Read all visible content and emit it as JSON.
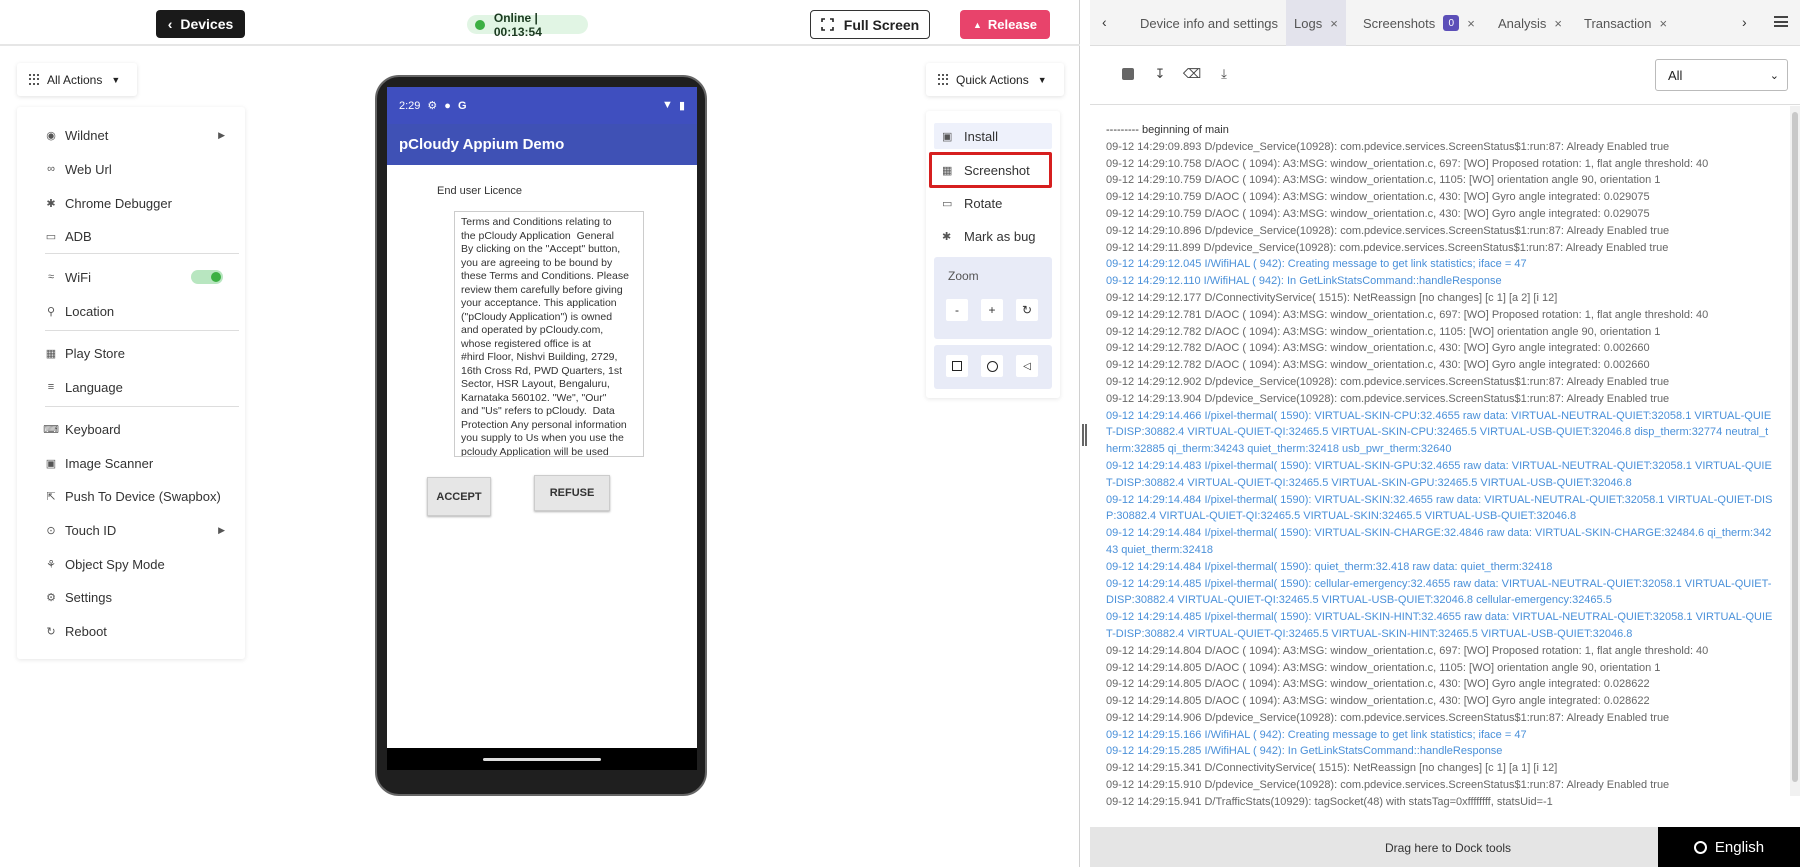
{
  "topbar": {
    "devices_label": "Devices",
    "status_text": "Online | 00:13:54",
    "fullscreen_label": "Full Screen",
    "release_label": "Release"
  },
  "all_actions": {
    "label": "All Actions",
    "items": [
      {
        "label": "Wildnet",
        "icon": "wildnet-icon"
      },
      {
        "label": "Web Url",
        "icon": "link-icon"
      },
      {
        "label": "Chrome Debugger",
        "icon": "bug-icon"
      },
      {
        "label": "ADB",
        "icon": "terminal-icon"
      },
      {
        "label": "WiFi",
        "icon": "wifi-icon"
      },
      {
        "label": "Location",
        "icon": "location-icon"
      },
      {
        "label": "Play Store",
        "icon": "apps-icon"
      },
      {
        "label": "Language",
        "icon": "language-icon"
      },
      {
        "label": "Keyboard",
        "icon": "keyboard-icon"
      },
      {
        "label": "Image Scanner",
        "icon": "scanner-icon"
      },
      {
        "label": "Push To Device (Swapbox)",
        "icon": "push-icon"
      },
      {
        "label": "Touch ID",
        "icon": "fingerprint-icon"
      },
      {
        "label": "Object Spy Mode",
        "icon": "spy-icon"
      },
      {
        "label": "Settings",
        "icon": "gear-icon"
      },
      {
        "label": "Reboot",
        "icon": "reboot-icon"
      }
    ]
  },
  "phone": {
    "time": "2:29",
    "status_g": "G",
    "app_title": "pCloudy Appium Demo",
    "licence_title": "End user Licence",
    "terms_text": "Terms and Conditions relating to\nthe pCloudy Application  General\nBy clicking on the \"Accept\" button,\nyou are agreeing to be bound by\nthese Terms and Conditions. Please\nreview them carefully before giving\nyour acceptance. This application\n(\"pCloudy Application\") is owned\nand operated by pCloudy.com,\nwhose registered office is at\n#hird Floor, Nishvi Building, 2729,\n16th Cross Rd, PWD Quarters, 1st\nSector, HSR Layout, Bengaluru,\nKarnataka 560102. \"We\", \"Our\"\nand \"Us\" refers to pCloudy.  Data\nProtection Any personal information\nyou supply to Us when you use the\npcloudy Application will be used\nin accordance with Our Privacy\nPolicy which can be viewed at",
    "accept_label": "ACCEPT",
    "refuse_label": "REFUSE"
  },
  "quick_actions": {
    "label": "Quick Actions",
    "install": "Install",
    "screenshot": "Screenshot",
    "rotate": "Rotate",
    "mark_bug": "Mark as bug",
    "zoom_label": "Zoom",
    "zoom_out": "-",
    "zoom_in": "+"
  },
  "dock": {
    "tabs": [
      {
        "label": "Device info and settings"
      },
      {
        "label": "Logs"
      },
      {
        "label": "Screenshots",
        "badge": "0"
      },
      {
        "label": "Analysis"
      },
      {
        "label": "Transaction"
      }
    ],
    "filter_value": "All",
    "drag_hint": "Drag here to Dock tools",
    "language": "English"
  },
  "logs": [
    {
      "t": "--------- beginning of main",
      "k": "head"
    },
    {
      "t": "09-12 14:29:09.893 D/pdevice_Service(10928): com.pdevice.services.ScreenStatus$1:run:87: Already Enabled true",
      "k": "d"
    },
    {
      "t": "09-12 14:29:10.758 D/AOC ( 1094): A3:MSG: window_orientation.c, 697: [WO] Proposed rotation: 1, flat angle threshold: 40",
      "k": "d"
    },
    {
      "t": "09-12 14:29:10.759 D/AOC ( 1094): A3:MSG: window_orientation.c, 1105: [WO] orientation angle 90, orientation 1",
      "k": "d"
    },
    {
      "t": "09-12 14:29:10.759 D/AOC ( 1094): A3:MSG: window_orientation.c, 430: [WO] Gyro angle integrated: 0.029075",
      "k": "d"
    },
    {
      "t": "09-12 14:29:10.759 D/AOC ( 1094): A3:MSG: window_orientation.c, 430: [WO] Gyro angle integrated: 0.029075",
      "k": "d"
    },
    {
      "t": "09-12 14:29:10.896 D/pdevice_Service(10928): com.pdevice.services.ScreenStatus$1:run:87: Already Enabled true",
      "k": "d"
    },
    {
      "t": "09-12 14:29:11.899 D/pdevice_Service(10928): com.pdevice.services.ScreenStatus$1:run:87: Already Enabled true",
      "k": "d"
    },
    {
      "t": "09-12 14:29:12.045 I/WifiHAL ( 942): Creating message to get link statistics; iface = 47",
      "k": "i"
    },
    {
      "t": "09-12 14:29:12.110 I/WifiHAL ( 942): In GetLinkStatsCommand::handleResponse",
      "k": "i"
    },
    {
      "t": "09-12 14:29:12.177 D/ConnectivityService( 1515): NetReassign [no changes] [c 1] [a 2] [i 12]",
      "k": "d"
    },
    {
      "t": "09-12 14:29:12.781 D/AOC ( 1094): A3:MSG: window_orientation.c, 697: [WO] Proposed rotation: 1, flat angle threshold: 40",
      "k": "d"
    },
    {
      "t": "09-12 14:29:12.782 D/AOC ( 1094): A3:MSG: window_orientation.c, 1105: [WO] orientation angle 90, orientation 1",
      "k": "d"
    },
    {
      "t": "09-12 14:29:12.782 D/AOC ( 1094): A3:MSG: window_orientation.c, 430: [WO] Gyro angle integrated: 0.002660",
      "k": "d"
    },
    {
      "t": "09-12 14:29:12.782 D/AOC ( 1094): A3:MSG: window_orientation.c, 430: [WO] Gyro angle integrated: 0.002660",
      "k": "d"
    },
    {
      "t": "09-12 14:29:12.902 D/pdevice_Service(10928): com.pdevice.services.ScreenStatus$1:run:87: Already Enabled true",
      "k": "d"
    },
    {
      "t": "09-12 14:29:13.904 D/pdevice_Service(10928): com.pdevice.services.ScreenStatus$1:run:87: Already Enabled true",
      "k": "d"
    },
    {
      "t": "09-12 14:29:14.466 I/pixel-thermal( 1590): VIRTUAL-SKIN-CPU:32.4655 raw data: VIRTUAL-NEUTRAL-QUIET:32058.1 VIRTUAL-QUIET-DISP:30882.4 VIRTUAL-QUIET-QI:32465.5 VIRTUAL-SKIN-CPU:32465.5 VIRTUAL-USB-QUIET:32046.8 disp_therm:32774 neutral_therm:32885 qi_therm:34243 quiet_therm:32418 usb_pwr_therm:32640",
      "k": "i"
    },
    {
      "t": "09-12 14:29:14.483 I/pixel-thermal( 1590): VIRTUAL-SKIN-GPU:32.4655 raw data: VIRTUAL-NEUTRAL-QUIET:32058.1 VIRTUAL-QUIET-DISP:30882.4 VIRTUAL-QUIET-QI:32465.5 VIRTUAL-SKIN-GPU:32465.5 VIRTUAL-USB-QUIET:32046.8",
      "k": "i"
    },
    {
      "t": "09-12 14:29:14.484 I/pixel-thermal( 1590): VIRTUAL-SKIN:32.4655 raw data: VIRTUAL-NEUTRAL-QUIET:32058.1 VIRTUAL-QUIET-DISP:30882.4 VIRTUAL-QUIET-QI:32465.5 VIRTUAL-SKIN:32465.5 VIRTUAL-USB-QUIET:32046.8",
      "k": "i"
    },
    {
      "t": "09-12 14:29:14.484 I/pixel-thermal( 1590): VIRTUAL-SKIN-CHARGE:32.4846 raw data: VIRTUAL-SKIN-CHARGE:32484.6 qi_therm:34243 quiet_therm:32418",
      "k": "i"
    },
    {
      "t": "09-12 14:29:14.484 I/pixel-thermal( 1590): quiet_therm:32.418 raw data: quiet_therm:32418",
      "k": "i"
    },
    {
      "t": "09-12 14:29:14.485 I/pixel-thermal( 1590): cellular-emergency:32.4655 raw data: VIRTUAL-NEUTRAL-QUIET:32058.1 VIRTUAL-QUIET-DISP:30882.4 VIRTUAL-QUIET-QI:32465.5 VIRTUAL-USB-QUIET:32046.8 cellular-emergency:32465.5",
      "k": "i"
    },
    {
      "t": "09-12 14:29:14.485 I/pixel-thermal( 1590): VIRTUAL-SKIN-HINT:32.4655 raw data: VIRTUAL-NEUTRAL-QUIET:32058.1 VIRTUAL-QUIET-DISP:30882.4 VIRTUAL-QUIET-QI:32465.5 VIRTUAL-SKIN-HINT:32465.5 VIRTUAL-USB-QUIET:32046.8",
      "k": "i"
    },
    {
      "t": "09-12 14:29:14.804 D/AOC ( 1094): A3:MSG: window_orientation.c, 697: [WO] Proposed rotation: 1, flat angle threshold: 40",
      "k": "d"
    },
    {
      "t": "09-12 14:29:14.805 D/AOC ( 1094): A3:MSG: window_orientation.c, 1105: [WO] orientation angle 90, orientation 1",
      "k": "d"
    },
    {
      "t": "09-12 14:29:14.805 D/AOC ( 1094): A3:MSG: window_orientation.c, 430: [WO] Gyro angle integrated: 0.028622",
      "k": "d"
    },
    {
      "t": "09-12 14:29:14.805 D/AOC ( 1094): A3:MSG: window_orientation.c, 430: [WO] Gyro angle integrated: 0.028622",
      "k": "d"
    },
    {
      "t": "09-12 14:29:14.906 D/pdevice_Service(10928): com.pdevice.services.ScreenStatus$1:run:87: Already Enabled true",
      "k": "d"
    },
    {
      "t": "09-12 14:29:15.166 I/WifiHAL ( 942): Creating message to get link statistics; iface = 47",
      "k": "i"
    },
    {
      "t": "09-12 14:29:15.285 I/WifiHAL ( 942): In GetLinkStatsCommand::handleResponse",
      "k": "i"
    },
    {
      "t": "09-12 14:29:15.341 D/ConnectivityService( 1515): NetReassign [no changes] [c 1] [a 1] [i 12]",
      "k": "d"
    },
    {
      "t": "09-12 14:29:15.910 D/pdevice_Service(10928): com.pdevice.services.ScreenStatus$1:run:87: Already Enabled true",
      "k": "d"
    },
    {
      "t": "09-12 14:29:15.941 D/TrafficStats(10929): tagSocket(48) with statsTag=0xffffffff, statsUid=-1",
      "k": "d"
    }
  ],
  "colors": {
    "release": "#e8436b",
    "appbar": "#3f51b5",
    "info_log": "#4a90d9",
    "highlight": "#d61f1f",
    "online": "#3cb043"
  }
}
